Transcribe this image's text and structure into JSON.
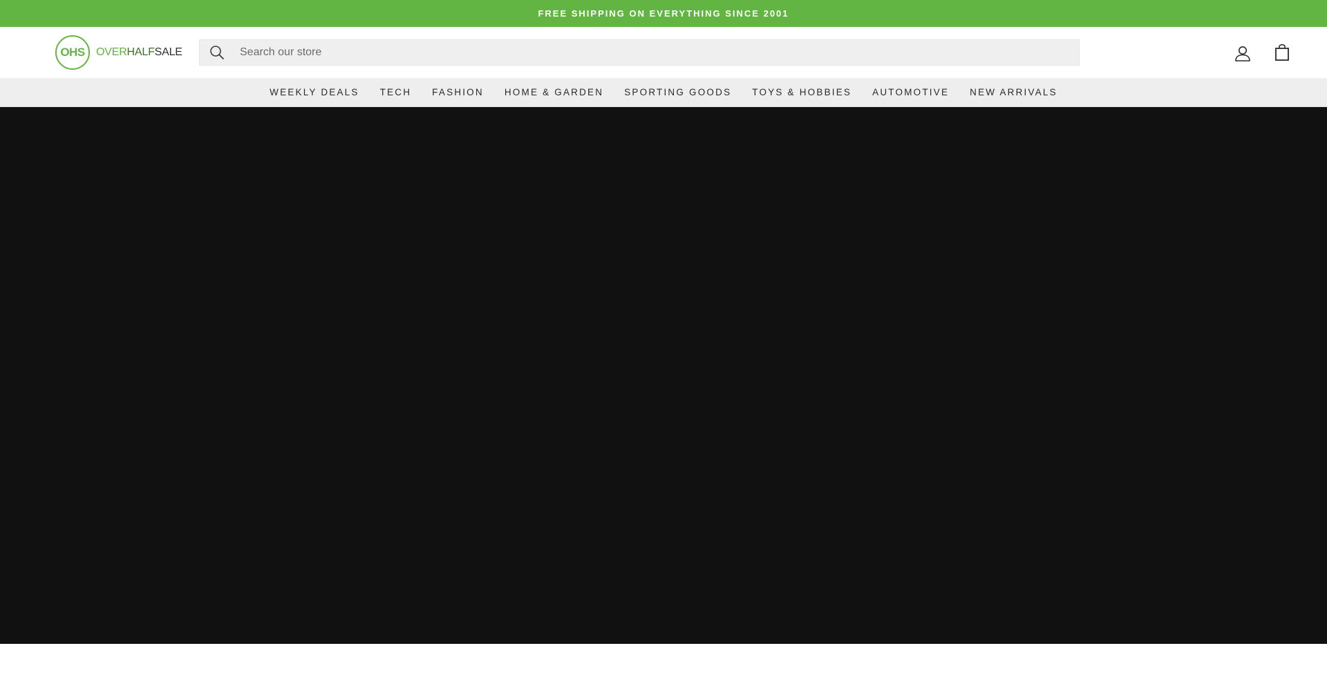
{
  "announcement": {
    "text": "FREE SHIPPING ON EVERYTHING SINCE 2001"
  },
  "header": {
    "logo": {
      "mark": "OHS",
      "word_over": "OVER",
      "word_half": "HALF",
      "word_sale": "SALE"
    },
    "search": {
      "placeholder": "Search our store",
      "value": "",
      "icon": "search-icon"
    },
    "icons": {
      "account": "account-icon",
      "cart": "cart-icon"
    }
  },
  "nav": {
    "items": [
      {
        "label": "WEEKLY DEALS"
      },
      {
        "label": "TECH"
      },
      {
        "label": "FASHION"
      },
      {
        "label": "HOME & GARDEN"
      },
      {
        "label": "SPORTING GOODS"
      },
      {
        "label": "TOYS & HOBBIES"
      },
      {
        "label": "AUTOMOTIVE"
      },
      {
        "label": "NEW ARRIVALS"
      }
    ]
  },
  "colors": {
    "brand_green": "#62b542",
    "nav_background": "#eeeeee",
    "hero_background": "#111111"
  }
}
